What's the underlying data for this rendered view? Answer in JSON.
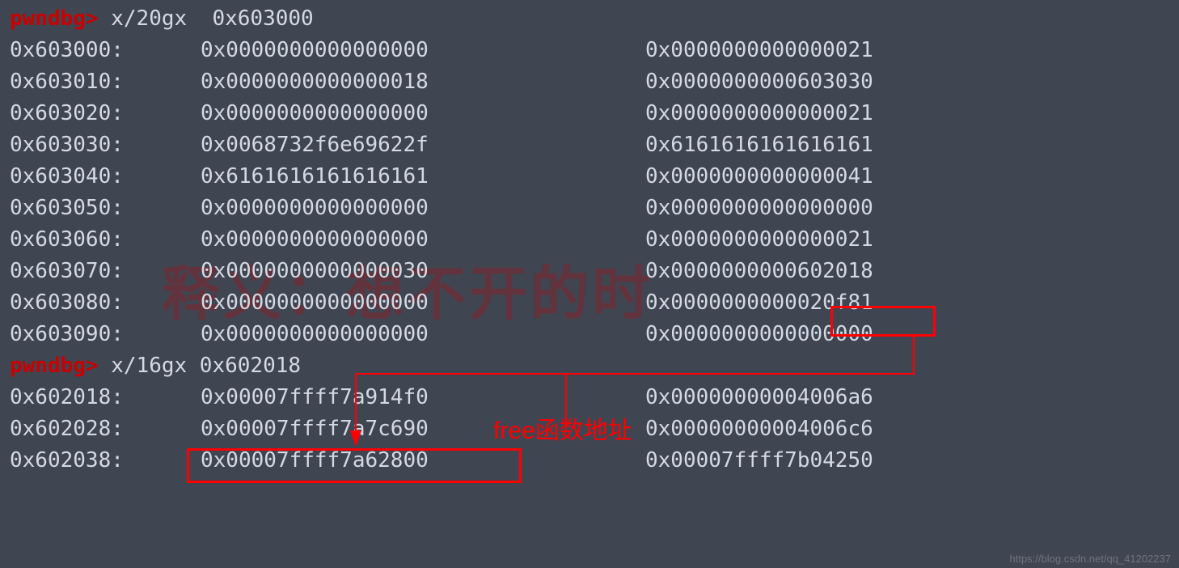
{
  "prompt": "pwndbg> ",
  "cmd1": "x/20gx  0x603000",
  "cmd2": "x/16gx 0x602018",
  "dump1": [
    {
      "addr": "0x603000:",
      "v1": "0x0000000000000000",
      "v2": "0x0000000000000021"
    },
    {
      "addr": "0x603010:",
      "v1": "0x0000000000000018",
      "v2": "0x0000000000603030"
    },
    {
      "addr": "0x603020:",
      "v1": "0x0000000000000000",
      "v2": "0x0000000000000021"
    },
    {
      "addr": "0x603030:",
      "v1": "0x0068732f6e69622f",
      "v2": "0x6161616161616161"
    },
    {
      "addr": "0x603040:",
      "v1": "0x6161616161616161",
      "v2": "0x0000000000000041"
    },
    {
      "addr": "0x603050:",
      "v1": "0x0000000000000000",
      "v2": "0x0000000000000000"
    },
    {
      "addr": "0x603060:",
      "v1": "0x0000000000000000",
      "v2": "0x0000000000000021"
    },
    {
      "addr": "0x603070:",
      "v1": "0x0000000000000030",
      "v2": "0x0000000000602018"
    },
    {
      "addr": "0x603080:",
      "v1": "0x0000000000000000",
      "v2": "0x0000000000020f81"
    },
    {
      "addr": "0x603090:",
      "v1": "0x0000000000000000",
      "v2": "0x0000000000000000"
    }
  ],
  "dump2": [
    {
      "addr": "0x602018:",
      "v1": "0x00007ffff7a914f0",
      "v2": "0x00000000004006a6"
    },
    {
      "addr": "0x602028:",
      "v1": "0x00007ffff7a7c690",
      "v2": "0x00000000004006c6"
    },
    {
      "addr": "0x602038:",
      "v1": "0x00007ffff7a62800",
      "v2": "0x00007ffff7b04250"
    }
  ],
  "annotation": "free函数地址",
  "watermark": "释义：想不开的时",
  "watermark_small": "https://blog.csdn.net/qq_41202237"
}
